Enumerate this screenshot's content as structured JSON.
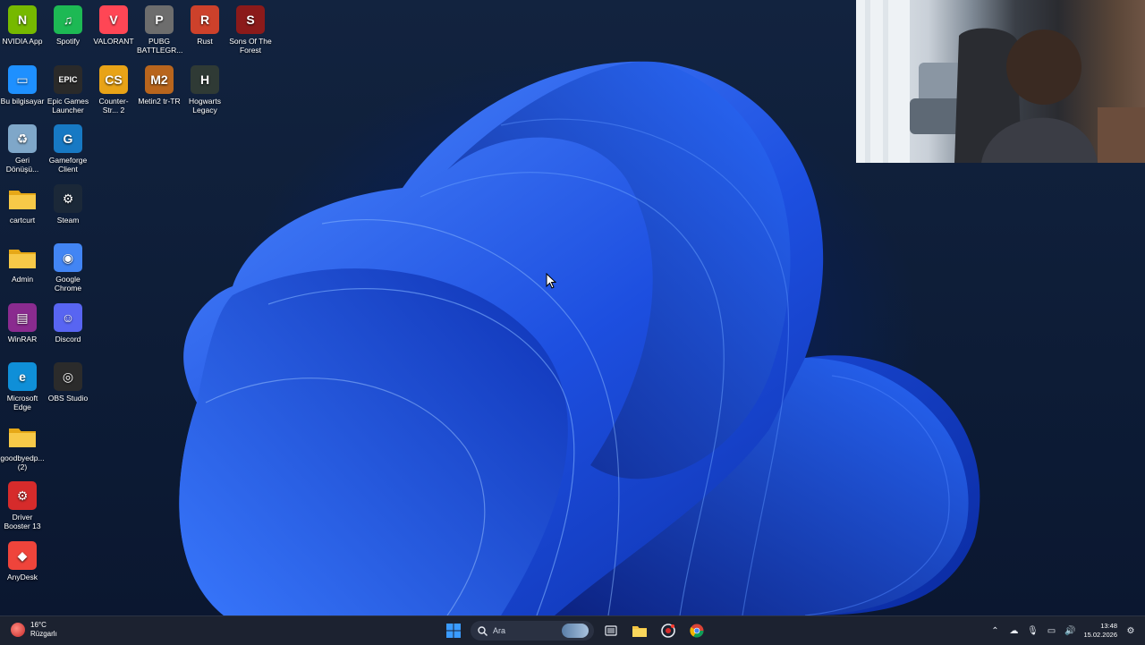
{
  "desktop_icons": [
    {
      "label": "NVIDIA App",
      "color": "#76b900",
      "glyph": "N",
      "icon": "nvidia-app-icon"
    },
    {
      "label": "Spotify",
      "color": "#1db954",
      "glyph": "♫",
      "icon": "spotify-icon"
    },
    {
      "label": "VALORANT",
      "color": "#ff4655",
      "glyph": "V",
      "icon": "valorant-icon"
    },
    {
      "label": "PUBG BATTLEGR...",
      "color": "#6d6d6d",
      "glyph": "P",
      "icon": "pubg-icon"
    },
    {
      "label": "Rust",
      "color": "#cd412b",
      "glyph": "R",
      "icon": "rust-icon"
    },
    {
      "label": "Sons Of The Forest",
      "color": "#8b1a1a",
      "glyph": "S",
      "icon": "sons-of-the-forest-icon"
    },
    {
      "label": "Bu bilgisayar",
      "color": "#1e90ff",
      "glyph": "▭",
      "icon": "this-pc-icon"
    },
    {
      "label": "Epic Games Launcher",
      "color": "#2a2a2a",
      "glyph": "EPIC",
      "icon": "epic-games-icon"
    },
    {
      "label": "Counter-Str... 2",
      "color": "#e8a317",
      "glyph": "CS",
      "icon": "counter-strike-icon"
    },
    {
      "label": "Metin2 tr-TR",
      "color": "#b8651d",
      "glyph": "M2",
      "icon": "metin2-icon"
    },
    {
      "label": "Hogwarts Legacy",
      "color": "#2f3a35",
      "glyph": "H",
      "icon": "hogwarts-legacy-icon"
    },
    {
      "label": "Geri Dönüşü...",
      "color": "#7fa7c9",
      "glyph": "♻",
      "icon": "recycle-bin-icon"
    },
    {
      "label": "Gameforge Client",
      "color": "#1779c4",
      "glyph": "G",
      "icon": "gameforge-icon"
    },
    {
      "label": "cartcurt",
      "color": "#f5c542",
      "glyph": "",
      "icon": "folder-icon"
    },
    {
      "label": "Steam",
      "color": "#1b2838",
      "glyph": "⚙",
      "icon": "steam-icon"
    },
    {
      "label": "Admin",
      "color": "#f5c542",
      "glyph": "",
      "icon": "folder-icon"
    },
    {
      "label": "Google Chrome",
      "color": "#4285f4",
      "glyph": "◉",
      "icon": "chrome-icon"
    },
    {
      "label": "WinRAR",
      "color": "#8a2b8f",
      "glyph": "▤",
      "icon": "winrar-icon"
    },
    {
      "label": "Discord",
      "color": "#5865f2",
      "glyph": "☺",
      "icon": "discord-icon"
    },
    {
      "label": "Microsoft Edge",
      "color": "#0f8fd8",
      "glyph": "e",
      "icon": "edge-icon"
    },
    {
      "label": "OBS Studio",
      "color": "#2b2b2b",
      "glyph": "◎",
      "icon": "obs-studio-icon"
    },
    {
      "label": "goodbyedp... (2)",
      "color": "#f5c542",
      "glyph": "",
      "icon": "folder-icon"
    },
    {
      "label": "Driver Booster 13",
      "color": "#d62b2b",
      "glyph": "⚙",
      "icon": "driver-booster-icon"
    },
    {
      "label": "AnyDesk",
      "color": "#ef443b",
      "glyph": "◆",
      "icon": "anydesk-icon"
    }
  ],
  "taskbar": {
    "weather_temp": "16°C",
    "weather_desc": "Rüzgarlı",
    "search_placeholder": "Ara",
    "time": "13:48",
    "date": "15.02.2026"
  },
  "colors": {
    "taskbar_bg": "#1c2230",
    "wallpaper_accent": "#1f5fff"
  }
}
